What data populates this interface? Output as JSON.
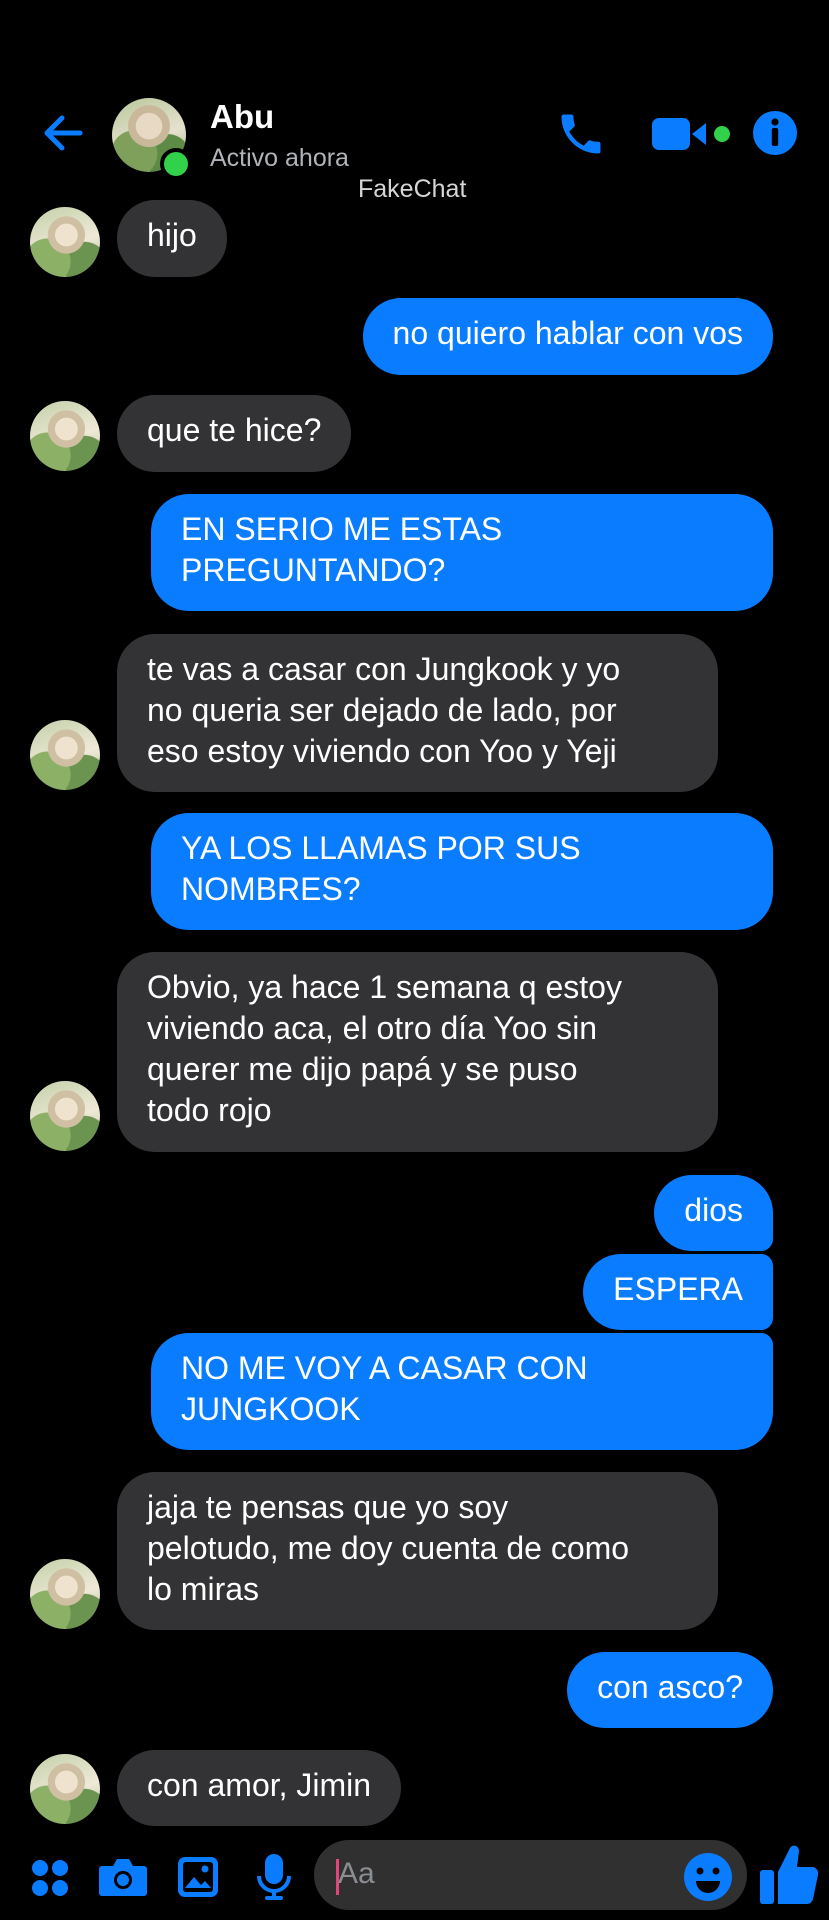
{
  "header": {
    "contact_name": "Abu",
    "status": "Activo ahora",
    "watermark": "FakeChat",
    "icons": [
      "back-arrow-icon",
      "phone-icon",
      "video-camera-icon",
      "info-icon"
    ]
  },
  "messages": [
    {
      "side": "in",
      "text": "hijo"
    },
    {
      "side": "out",
      "text": "no quiero hablar con vos"
    },
    {
      "side": "in",
      "text": "que te hice?"
    },
    {
      "side": "out",
      "text": "EN SERIO ME ESTAS\nPREGUNTANDO?"
    },
    {
      "side": "in",
      "text": "te vas a casar con Jungkook y yo\nno queria ser dejado de lado, por\neso estoy viviendo con Yoo y Yeji"
    },
    {
      "side": "out",
      "text": "YA LOS LLAMAS POR SUS\nNOMBRES?"
    },
    {
      "side": "in",
      "text": "Obvio, ya hace 1 semana q estoy\nviviendo aca, el otro día Yoo sin\nquerer me dijo papá y se puso\ntodo rojo"
    },
    {
      "side": "out",
      "text": "dios"
    },
    {
      "side": "out",
      "text": "ESPERA"
    },
    {
      "side": "out",
      "text": "NO ME VOY A CASAR CON\nJUNGKOOK"
    },
    {
      "side": "in",
      "text": "jaja te pensas que yo soy\npelotudo, me doy cuenta de como\nlo miras"
    },
    {
      "side": "out",
      "text": "con asco?"
    },
    {
      "side": "in",
      "text": "con amor, Jimin"
    }
  ],
  "composer": {
    "placeholder": "Aa",
    "icons": [
      "apps-grid-icon",
      "camera-icon",
      "image-icon",
      "microphone-icon",
      "emoji-icon",
      "thumbs-up-icon"
    ]
  },
  "colors": {
    "accent": "#0a7cff",
    "incoming_bubble": "#333335",
    "background": "#000000",
    "online": "#31d14a"
  }
}
